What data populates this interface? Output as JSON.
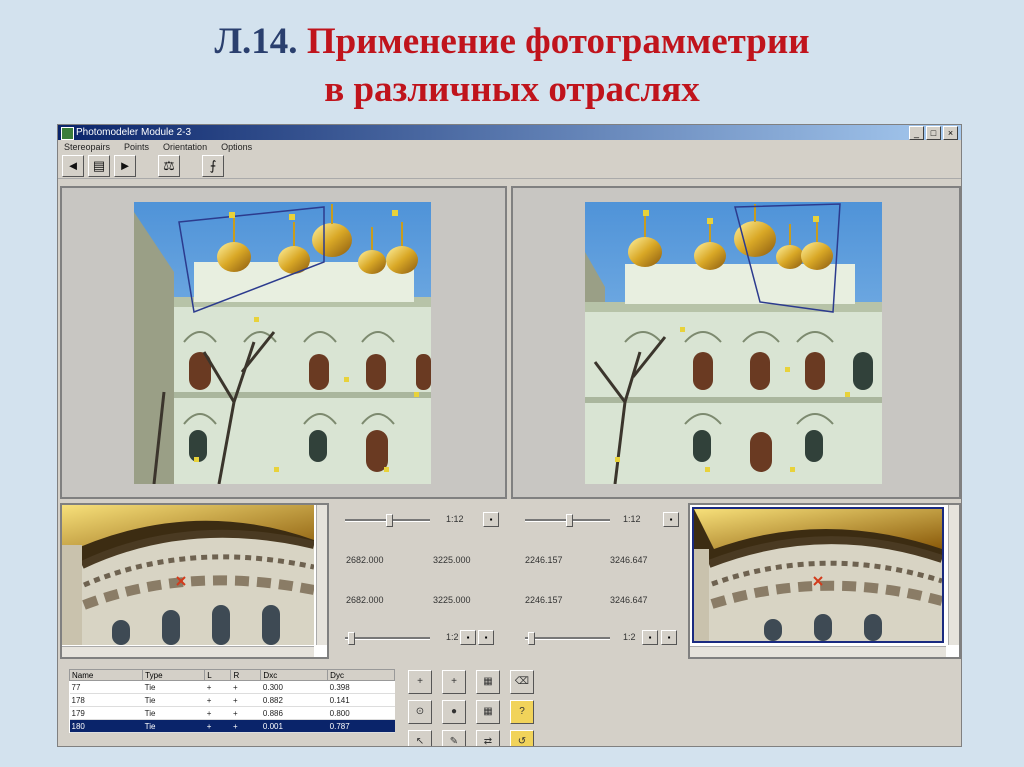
{
  "slide": {
    "number": "Л.14.",
    "title_line1": "Применение фотограмметрии",
    "title_line2": "в различных отраслях"
  },
  "window": {
    "title": "Photomodeler Module 2-3",
    "controls": [
      "_",
      "□",
      "×"
    ]
  },
  "menu": [
    "Stereopairs",
    "Points",
    "Orientation",
    "Options"
  ],
  "toolbar": [
    "◄",
    "▤",
    "►",
    "⚖",
    "⨍"
  ],
  "left_panel": {
    "zoom": "1:12",
    "coord_x1": "2682.000",
    "coord_y1": "3225.000",
    "coord_x2": "2682.000",
    "coord_y2": "3225.000",
    "zoom2": "1:2"
  },
  "right_panel": {
    "zoom": "1:12",
    "coord_x1": "2246.157",
    "coord_y1": "3246.647",
    "coord_x2": "2246.157",
    "coord_y2": "3246.647",
    "zoom2": "1:2"
  },
  "table": {
    "headers": [
      "Name",
      "Type",
      "L",
      "R",
      "Dxc",
      "Dyc"
    ],
    "rows": [
      [
        "77",
        "Tie",
        "+",
        "+",
        "0.300",
        "0.398"
      ],
      [
        "178",
        "Tie",
        "+",
        "+",
        "0.882",
        "0.141"
      ],
      [
        "179",
        "Tie",
        "+",
        "+",
        "0.886",
        "0.800"
      ],
      [
        "180",
        "Tie",
        "+",
        "+",
        "0.001",
        "0.787"
      ]
    ],
    "selected_row": 3
  },
  "tool_icons": [
    "+",
    "+",
    "▦",
    "⌫",
    "⊙",
    "●",
    "▦",
    "?",
    "↖",
    "✎",
    "⇄",
    "↺"
  ],
  "colors": {
    "title_red": "#c0141c",
    "title_blue": "#2a3f6e",
    "window_bg": "#d4d0c8",
    "selection": "#0a246a"
  }
}
